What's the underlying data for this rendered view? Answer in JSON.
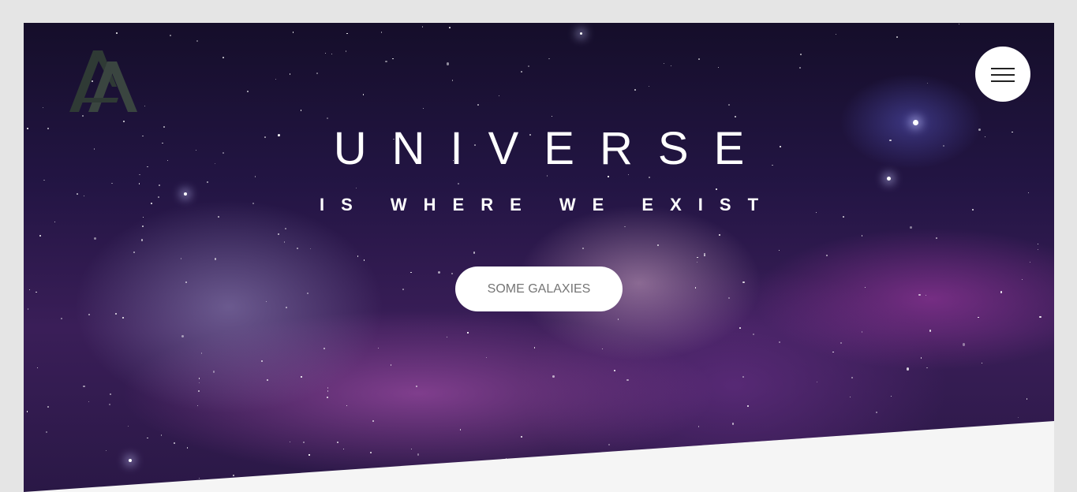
{
  "hero": {
    "title": "UNIVERSE",
    "subtitle": "IS WHERE WE EXIST",
    "cta_label": "SOME GALAXIES"
  },
  "logo": {
    "icon": "double-a-logo-icon",
    "color": "#3a3f3c"
  },
  "nav": {
    "menu_icon": "hamburger-menu-icon"
  },
  "colors": {
    "page_background": "#e5e5e5",
    "section_background": "#f5f5f5",
    "hero_text": "#ffffff",
    "button_background": "#ffffff",
    "button_text": "#757575"
  }
}
